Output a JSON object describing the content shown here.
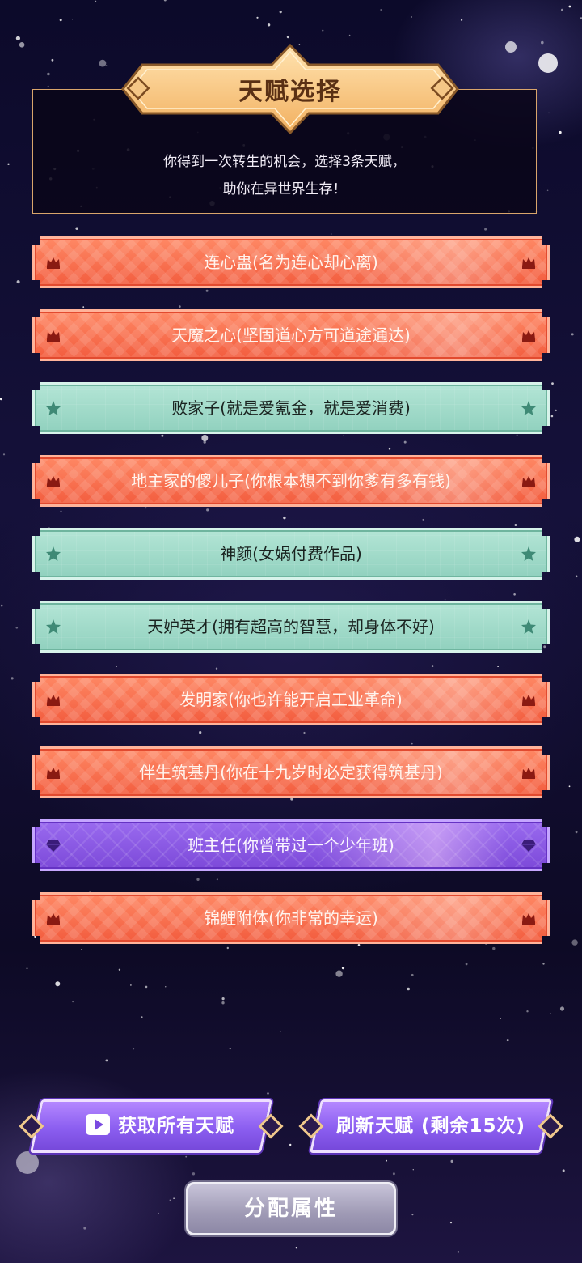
{
  "header": {
    "title": "天赋选择",
    "intro_line1": "你得到一次转生的机会，选择3条天赋，",
    "intro_line2": "助你在异世界生存！"
  },
  "talents": [
    {
      "label": "连心蛊(名为连心却心离)",
      "rarity": "red",
      "icon": "crown-icon"
    },
    {
      "label": "天魔之心(坚固道心方可道途通达)",
      "rarity": "red",
      "icon": "crown-icon"
    },
    {
      "label": "败家子(就是爱氪金，就是爱消费)",
      "rarity": "green",
      "icon": "star-icon"
    },
    {
      "label": "地主家的傻儿子(你根本想不到你爹有多有钱)",
      "rarity": "red",
      "icon": "crown-icon"
    },
    {
      "label": "神颜(女娲付费作品)",
      "rarity": "green",
      "icon": "star-icon"
    },
    {
      "label": "天妒英才(拥有超高的智慧，却身体不好)",
      "rarity": "green",
      "icon": "star-icon"
    },
    {
      "label": "发明家(你也许能开启工业革命)",
      "rarity": "red",
      "icon": "crown-icon"
    },
    {
      "label": "伴生筑基丹(你在十九岁时必定获得筑基丹)",
      "rarity": "red",
      "icon": "crown-icon"
    },
    {
      "label": "班主任(你曾带过一个少年班)",
      "rarity": "purple",
      "icon": "gem-icon"
    },
    {
      "label": "锦鲤附体(你非常的幸运)",
      "rarity": "red",
      "icon": "crown-icon"
    }
  ],
  "buttons": {
    "get_all": "获取所有天赋",
    "refresh": "刷新天赋 (剩余15次)",
    "assign": "分配属性"
  },
  "colors": {
    "red": "#f25a3c",
    "green": "#8fd0bd",
    "purple": "#7b48d8",
    "title_gold": "#f6c27a"
  }
}
